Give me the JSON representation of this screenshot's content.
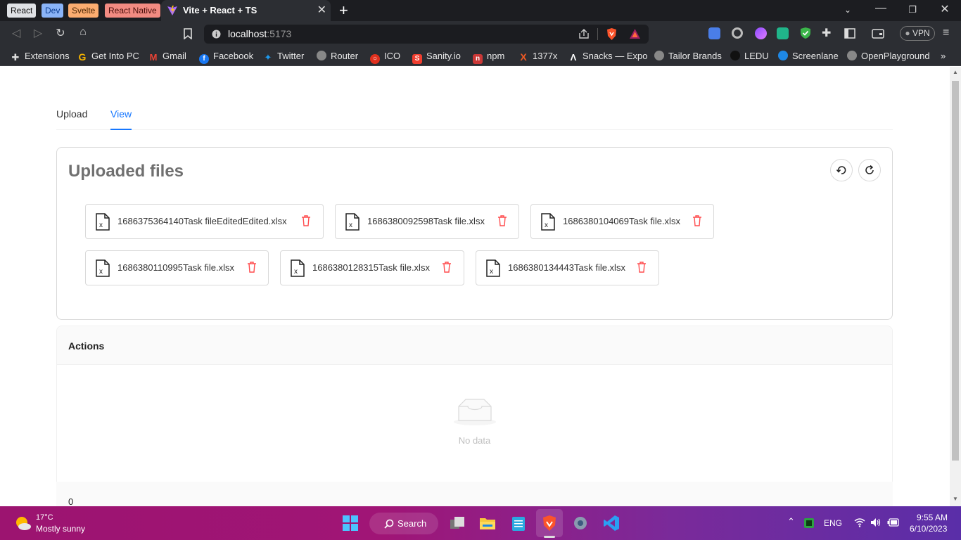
{
  "browser": {
    "tab_groups": [
      {
        "label": "React",
        "bg": "#dfe1e5",
        "fg": "#111"
      },
      {
        "label": "Dev",
        "bg": "#8ab4f8",
        "fg": "#0b3d91"
      },
      {
        "label": "Svelte",
        "bg": "#fcad70",
        "fg": "#4a2300"
      },
      {
        "label": "React Native",
        "bg": "#f28b82",
        "fg": "#4a0d09"
      }
    ],
    "active_tab_title": "Vite + React + TS",
    "url_host": "localhost",
    "url_port": ":5173",
    "vpn_label": "VPN",
    "bookmarks": [
      {
        "label": "Extensions",
        "icon": "puzzle-icon"
      },
      {
        "label": "Get Into PC",
        "icon": "g-icon"
      },
      {
        "label": "Gmail",
        "icon": "gmail-icon"
      },
      {
        "label": "Facebook",
        "icon": "facebook-icon"
      },
      {
        "label": "Twitter",
        "icon": "twitter-icon"
      },
      {
        "label": "Router",
        "icon": "globe-icon"
      },
      {
        "label": "ICO",
        "icon": "ico-icon"
      },
      {
        "label": "Sanity.io",
        "icon": "sanity-icon"
      },
      {
        "label": "npm",
        "icon": "npm-icon"
      },
      {
        "label": "1377x",
        "icon": "x-icon"
      },
      {
        "label": "Snacks — Expo",
        "icon": "expo-icon"
      },
      {
        "label": "Tailor Brands",
        "icon": "globe-icon"
      },
      {
        "label": "LEDU",
        "icon": "ledu-icon"
      },
      {
        "label": "Screenlane",
        "icon": "screenlane-icon"
      },
      {
        "label": "OpenPlayground",
        "icon": "globe-icon"
      }
    ],
    "more_bookmarks": "»"
  },
  "app": {
    "tabs": [
      {
        "label": "Upload",
        "active": false
      },
      {
        "label": "View",
        "active": true
      }
    ],
    "card_title": "Uploaded files",
    "files_row1": [
      "1686375364140Task fileEditedEdited.xlsx",
      "1686380092598Task file.xlsx",
      "1686380104069Task file.xlsx"
    ],
    "files_row2": [
      "1686380110995Task file.xlsx",
      "1686380128315Task file.xlsx",
      "1686380134443Task file.xlsx"
    ],
    "actions_title": "Actions",
    "empty_text": "No data",
    "footer_value": "0"
  },
  "taskbar": {
    "temperature": "17°C",
    "weather": "Mostly sunny",
    "search_label": "Search",
    "language": "ENG",
    "time": "9:55 AM",
    "date": "6/10/2023"
  },
  "colors": {
    "accent": "#1677ff",
    "danger": "#ff4d4f"
  }
}
